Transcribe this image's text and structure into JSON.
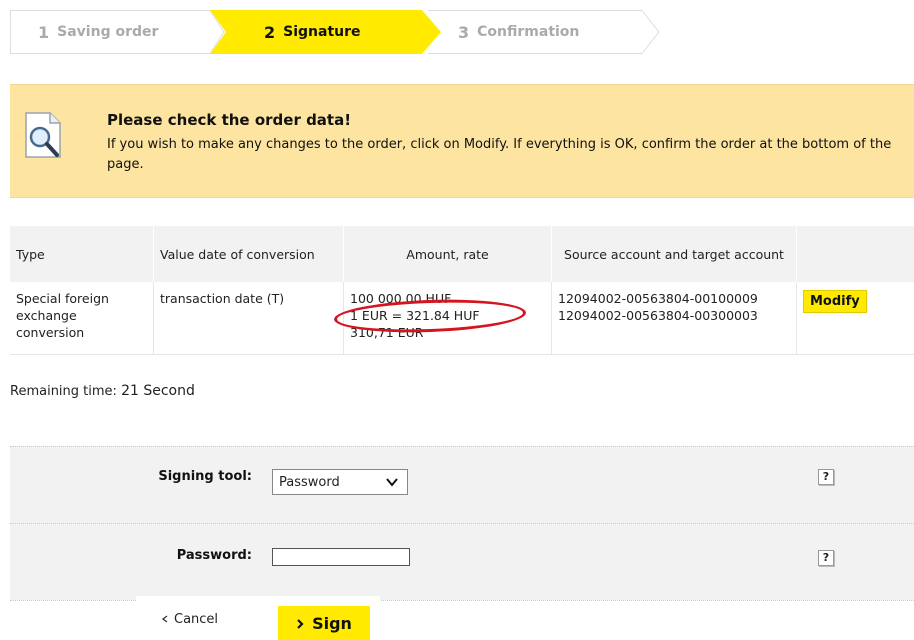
{
  "steps": [
    {
      "num": "1",
      "label": "Saving order",
      "state": "done"
    },
    {
      "num": "2",
      "label": "Signature",
      "state": "active"
    },
    {
      "num": "3",
      "label": "Confirmation",
      "state": "pending"
    }
  ],
  "notice": {
    "icon": "magnifier-document-icon",
    "title": "Please check the order data!",
    "text": "If you wish to make any changes to the order, click on Modify. If everything is OK, confirm the order at the bottom of the page."
  },
  "table": {
    "headers": [
      "Type",
      "Value date of conversion",
      "Amount, rate",
      "Source account and target account",
      ""
    ],
    "row": {
      "type": "Special foreign exchange conversion",
      "value_date": "transaction date (T)",
      "amount": "100 000,00 HUF",
      "rate": "1 EUR = 321.84 HUF",
      "converted": "310,71 EUR",
      "source_account": "12094002-00563804-00100009",
      "target_account": "12094002-00563804-00300003",
      "modify_label": "Modify"
    }
  },
  "remaining": {
    "label": "Remaining time:",
    "value": "21 Second"
  },
  "sign_form": {
    "tool_label": "Signing tool:",
    "tool_value": "Password",
    "password_label": "Password:",
    "help_label": "?"
  },
  "actions": {
    "cancel_label": "Cancel",
    "sign_label": "Sign"
  },
  "colors": {
    "accent_yellow": "#ffea00",
    "notice_bg": "#fde4a0",
    "highlight_red": "#d4141e"
  }
}
